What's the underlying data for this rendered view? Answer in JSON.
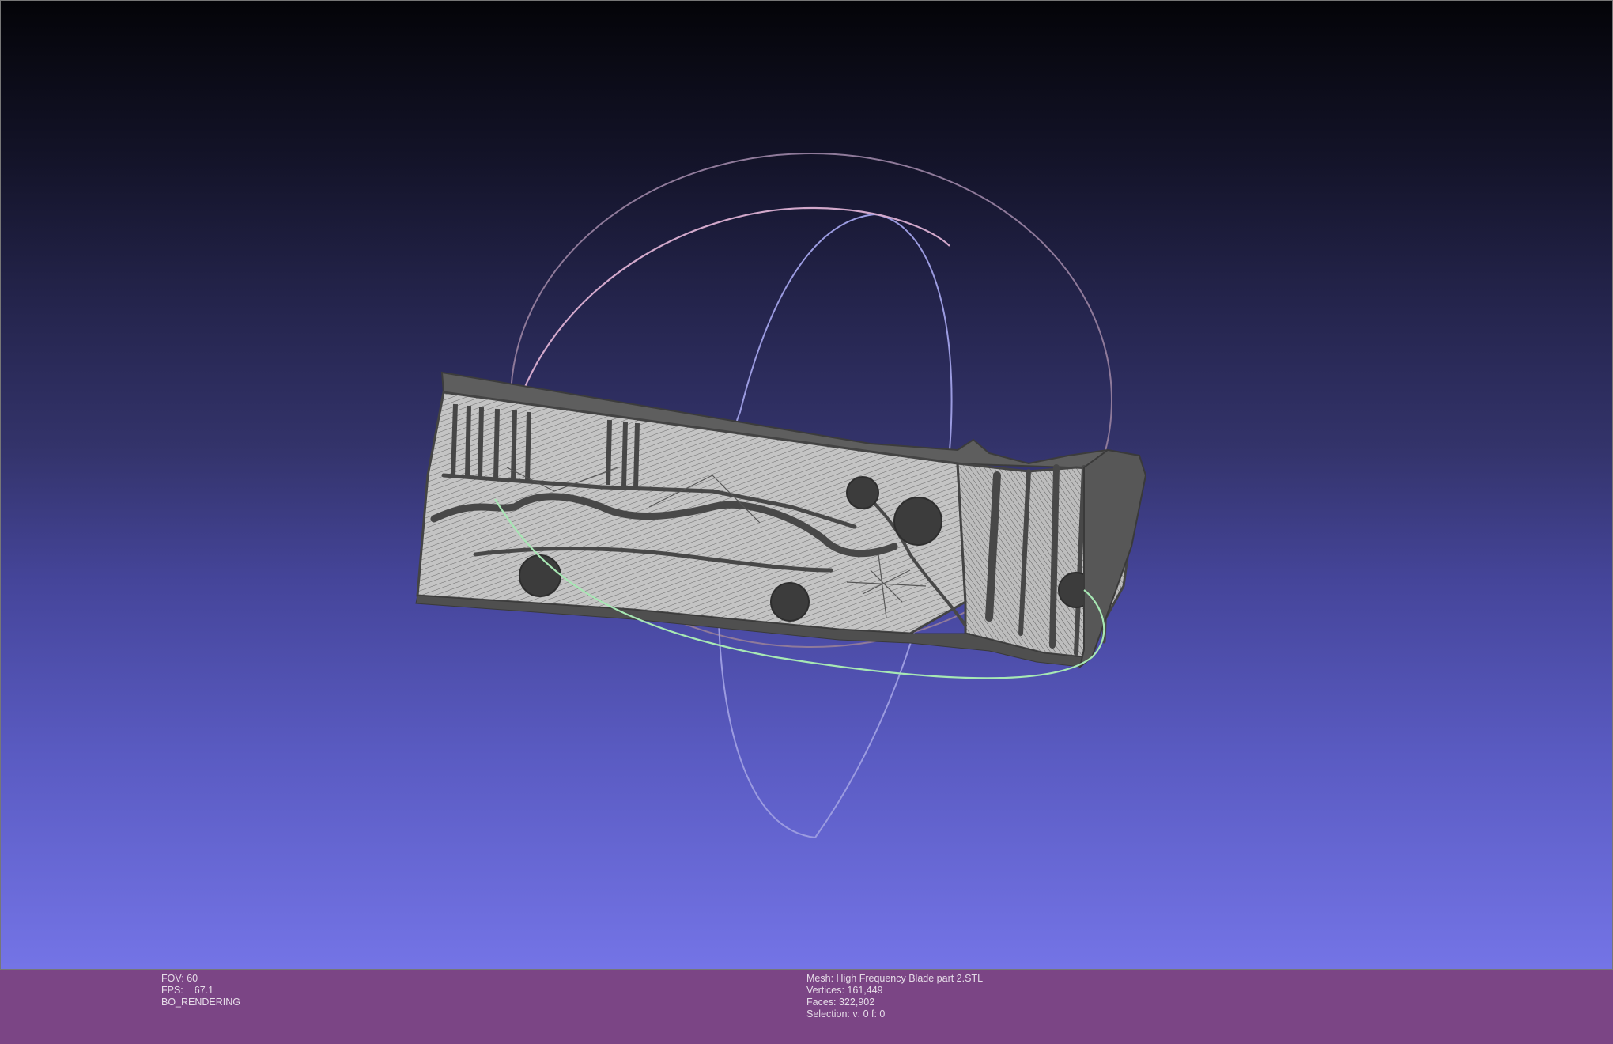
{
  "viewer": {
    "background_top": "#040408",
    "background_bottom": "#7474e6",
    "status_bar_color": "#7b4585",
    "mesh_fill_color": "#c4c4c4",
    "mesh_edge_color": "#4a4a4a",
    "trackball_colors": {
      "x_ring": "#cfa6c6",
      "y_ring": "#a9a9f0",
      "z_ring": "#a7e8b4"
    }
  },
  "status_left": {
    "fov_label": "FOV:",
    "fov_value": "60",
    "fps_label": "FPS:",
    "fps_value": "67.1",
    "render_mode": "BO_RENDERING"
  },
  "status_right": {
    "mesh": "Mesh: High Frequency Blade part 2.STL",
    "vertices": "Vertices: 161,449",
    "faces": "Faces: 322,902",
    "selection": "Selection: v: 0 f: 0"
  }
}
